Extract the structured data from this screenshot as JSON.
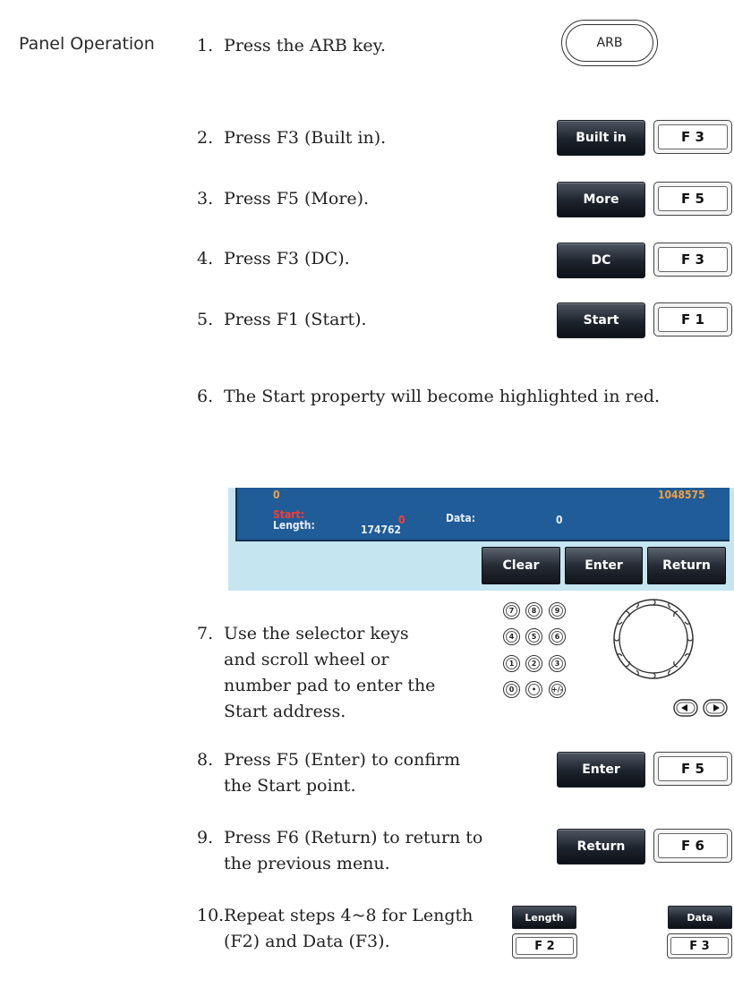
{
  "section_label": "Panel Operation",
  "steps": [
    {
      "num": "1.",
      "text": "Press the ARB key."
    },
    {
      "num": "2.",
      "text": "Press F3 (Built in)."
    },
    {
      "num": "3.",
      "text": "Press F5 (More)."
    },
    {
      "num": "4.",
      "text": "Press F3 (DC)."
    },
    {
      "num": "5.",
      "text": "Press F1 (Start)."
    },
    {
      "num": "6.",
      "text": "The Start property will become highlighted in red."
    },
    {
      "num": "7.",
      "text": "Use the selector keys and scroll wheel or number pad to enter the Start address."
    },
    {
      "num": "8.",
      "text": "Press F5 (Enter) to confirm the Start point."
    },
    {
      "num": "9.",
      "text": "Press F6 (Return) to return to the previous menu."
    },
    {
      "num": "10.",
      "text": "Repeat steps 4~8 for Length (F2) and Data (F3)."
    }
  ],
  "keys": {
    "arb": "ARB",
    "built_in": {
      "soft": "Built in",
      "f": "F 3"
    },
    "more": {
      "soft": "More",
      "f": "F 5"
    },
    "dc": {
      "soft": "DC",
      "f": "F 3"
    },
    "start": {
      "soft": "Start",
      "f": "F 1"
    },
    "enter": {
      "soft": "Enter",
      "f": "F 5"
    },
    "return": {
      "soft": "Return",
      "f": "F 6"
    },
    "length": {
      "soft": "Length",
      "f": "F 2"
    },
    "data": {
      "soft": "Data",
      "f": "F 3"
    }
  },
  "screen": {
    "range_start": "0",
    "range_end": "1048575",
    "start_label": "Start:",
    "start_value": "0",
    "length_label": "Length:",
    "length_value": "174762",
    "data_label": "Data:",
    "data_value": "0",
    "buttons": [
      "Clear",
      "Enter",
      "Return"
    ]
  },
  "keypad": [
    "7",
    "8",
    "9",
    "4",
    "5",
    "6",
    "1",
    "2",
    "3",
    "0",
    "•",
    "+/-"
  ],
  "colors": {
    "screen_panel": "#1f5c98",
    "screen_background": "#c5e5f1",
    "highlight_red": "#ff3b30",
    "value_orange": "#f0a040"
  }
}
